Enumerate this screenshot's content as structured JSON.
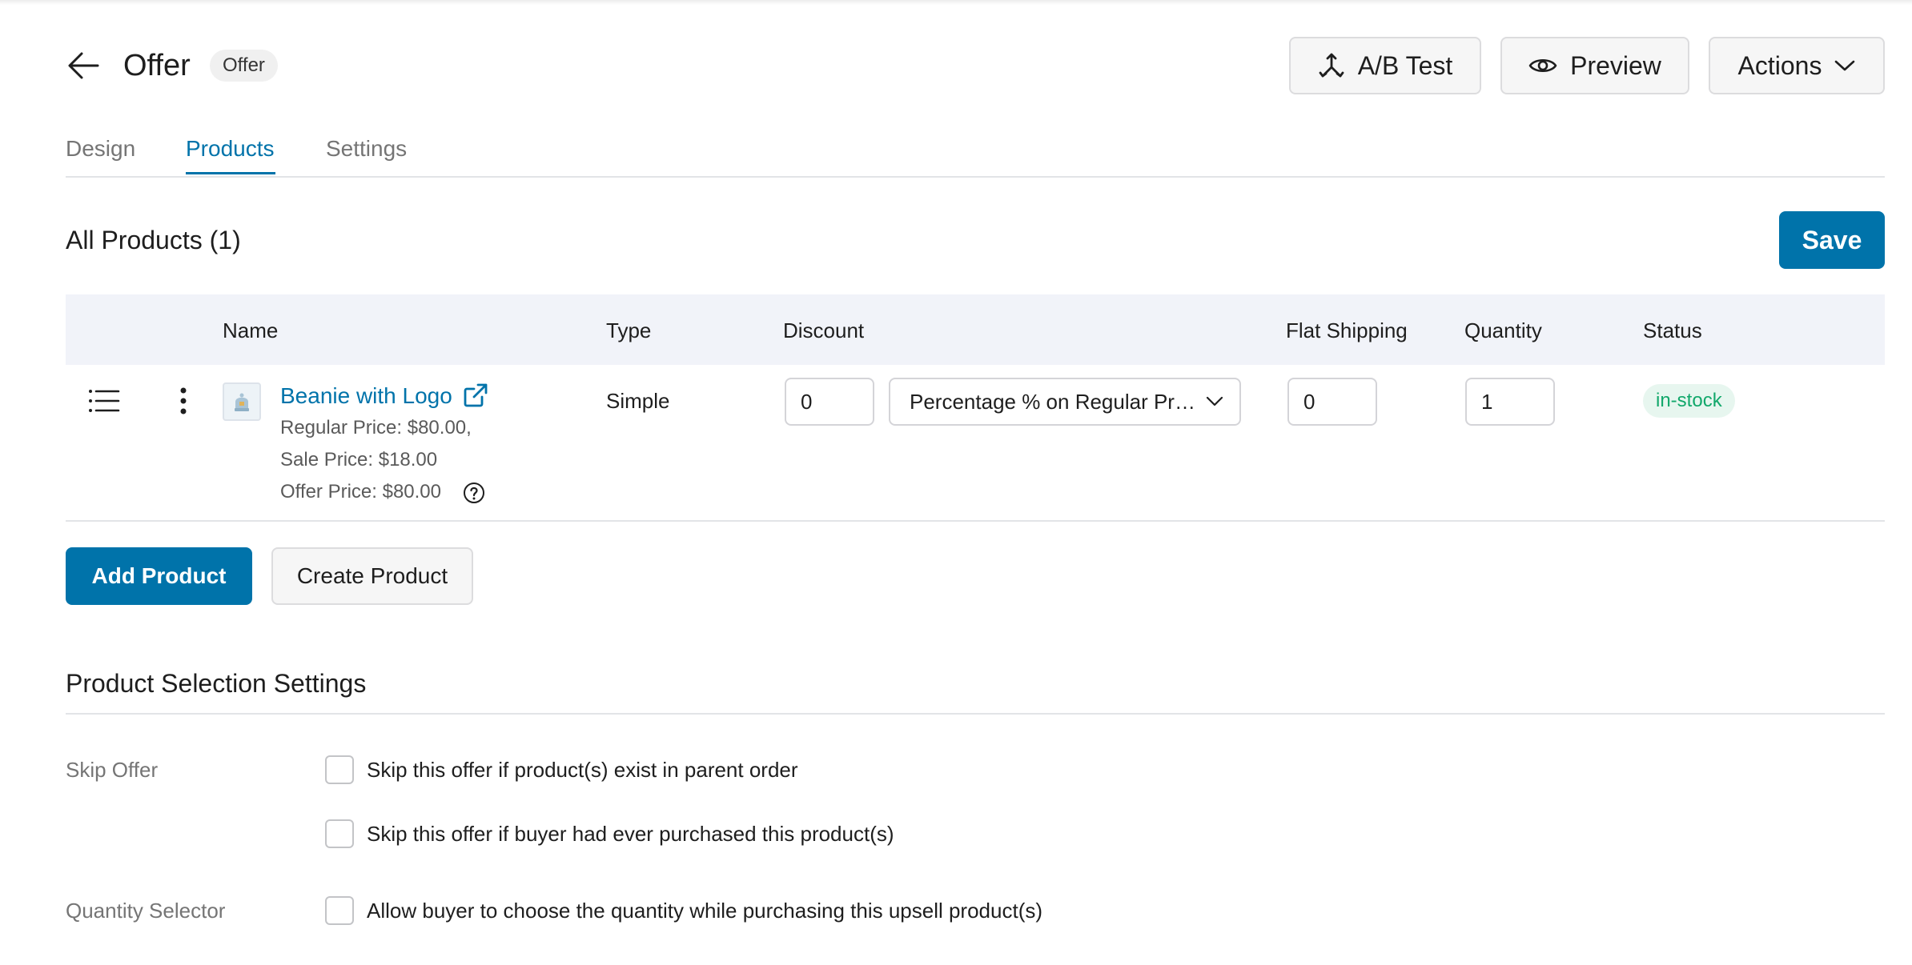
{
  "header": {
    "title": "Offer",
    "badge": "Offer",
    "ab_test_label": "A/B Test",
    "preview_label": "Preview",
    "actions_label": "Actions"
  },
  "tabs": [
    {
      "label": "Design",
      "active": false
    },
    {
      "label": "Products",
      "active": true
    },
    {
      "label": "Settings",
      "active": false
    }
  ],
  "products_section": {
    "title": "All Products (1)",
    "save_label": "Save",
    "columns": [
      "Name",
      "Type",
      "Discount",
      "Flat Shipping",
      "Quantity",
      "Status"
    ],
    "rows": [
      {
        "name": "Beanie with Logo",
        "regular_price": "Regular Price: $80.00,",
        "sale_price": "Sale Price: $18.00",
        "offer_price": "Offer Price: $80.00",
        "type": "Simple",
        "discount_value": "0",
        "discount_mode": "Percentage % on Regular Price",
        "flat_shipping": "0",
        "quantity": "1",
        "status": "in-stock"
      }
    ],
    "add_product_label": "Add Product",
    "create_product_label": "Create Product"
  },
  "selection_settings": {
    "title": "Product Selection Settings",
    "skip_offer_label": "Skip Offer",
    "skip_option_1": "Skip this offer if product(s) exist in parent order",
    "skip_option_2": "Skip this offer if buyer had ever purchased this product(s)",
    "quantity_selector_label": "Quantity Selector",
    "quantity_option": "Allow buyer to choose the quantity while purchasing this upsell product(s)"
  },
  "colors": {
    "accent": "#0073aa",
    "status_text": "#12a86b",
    "status_bg": "#e7f6ef",
    "table_header_bg": "#f1f3f9"
  },
  "icons": [
    "back-arrow-icon",
    "ab-test-split-icon",
    "eye-icon",
    "chevron-down-icon",
    "drag-handle-icon",
    "kebab-menu-icon",
    "product-thumbnail-icon",
    "external-link-icon",
    "help-icon"
  ]
}
